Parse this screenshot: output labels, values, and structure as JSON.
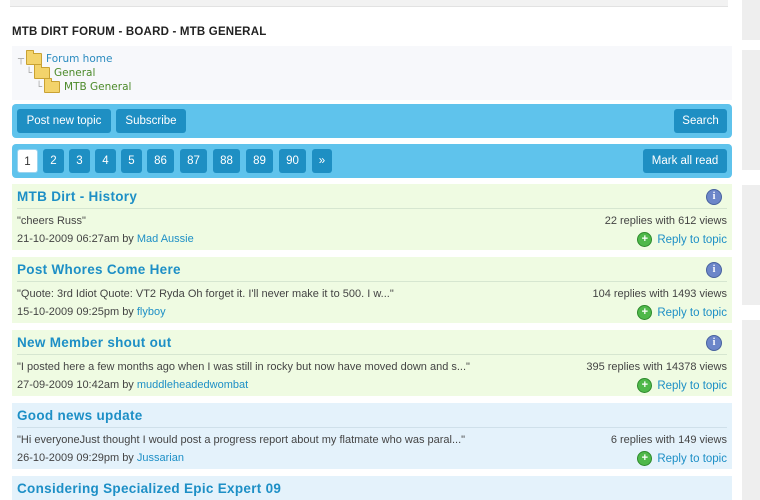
{
  "page": {
    "title": "MTB DIRT FORUM - BOARD - MTB GENERAL"
  },
  "breadcrumb": [
    {
      "label": "Forum home"
    },
    {
      "label": "General"
    },
    {
      "label": "MTB General"
    }
  ],
  "toolbar": {
    "post_new_topic": "Post new topic",
    "subscribe": "Subscribe",
    "search": "Search"
  },
  "pagination": {
    "pages": [
      "1",
      "2",
      "3",
      "4",
      "5",
      "86",
      "87",
      "88",
      "89",
      "90"
    ],
    "current": "1",
    "next": "»",
    "mark_all_read": "Mark all read"
  },
  "topics": [
    {
      "title": "MTB Dirt - History",
      "excerpt": "\"cheers Russ\"",
      "stats": "22 replies with 612 views",
      "date": "21-10-2009 06:27am by",
      "author": "Mad Aussie",
      "reply": "Reply to topic",
      "status": "read"
    },
    {
      "title": "Post Whores Come Here",
      "excerpt": "\"Quote: 3rd Idiot Quote: VT2 Ryda Oh forget it. I'll never make it to 500. I w...\"",
      "stats": "104 replies with 1493 views",
      "date": "15-10-2009 09:25pm by",
      "author": "flyboy",
      "reply": "Reply to topic",
      "status": "read"
    },
    {
      "title": "New Member shout out",
      "excerpt": "\"I posted here a few months ago when I was still in rocky but now have moved down and s...\"",
      "stats": "395 replies with 14378 views",
      "date": "27-09-2009 10:42am by",
      "author": "muddleheadedwombat",
      "reply": "Reply to topic",
      "status": "read"
    },
    {
      "title": "Good news update",
      "excerpt": "\"Hi everyoneJust thought I would post a progress report about my flatmate who was paral...\"",
      "stats": "6 replies with 149 views",
      "date": "26-10-2009 09:29pm by",
      "author": "Jussarian",
      "reply": "Reply to topic",
      "status": "unread"
    },
    {
      "title": "Considering Specialized Epic Expert 09"
    }
  ],
  "colors": {
    "toolbar_bg": "#5fc3ec",
    "button_bg": "#1e8fc3",
    "link": "#1d8fc6",
    "topic_read_bg": "#effbe2",
    "topic_unread_bg": "#e4f2fb"
  },
  "icons": {
    "folder": "folder-icon",
    "info": "info-icon",
    "reply": "plus-circle-icon"
  }
}
